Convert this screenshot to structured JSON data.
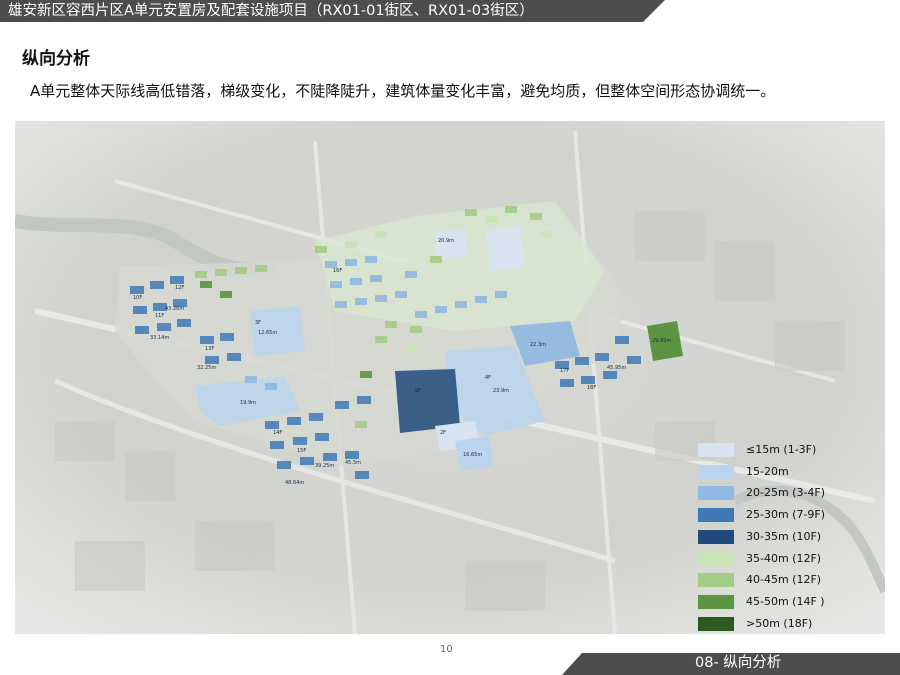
{
  "header": {
    "title": "雄安新区容西片区A单元安置房及配套设施项目（RX01-01街区、RX01-03街区）",
    "banner_color": "#4d4d4d"
  },
  "section": {
    "title": "纵向分析",
    "description": "A单元整体天际线高低错落，梯级变化，不陡降陡升，建筑体量变化丰富，避免均质，但整体空间形态协调统一。"
  },
  "map": {
    "building_labels": [
      "10F",
      "11F",
      "12F",
      "13F",
      "14F",
      "15F",
      "16F",
      "17F",
      "18F",
      "3F",
      "4F",
      "2F",
      "9F",
      "12.65m",
      "16.65m",
      "19.9m",
      "20.9m",
      "22.3m",
      "23.9m",
      "29.45m",
      "32.25m",
      "33.14m",
      "39.25m",
      "43.26m",
      "45.5m",
      "45.95m",
      "48.64m"
    ]
  },
  "legend": {
    "items": [
      {
        "label": "≤15m (1-3F)",
        "color": "#d7e3ef"
      },
      {
        "label": "15-20m",
        "color": "#bcd5ec"
      },
      {
        "label": "20-25m (3-4F)",
        "color": "#8fb8e2"
      },
      {
        "label": "25-30m (7-9F)",
        "color": "#3f79b6"
      },
      {
        "label": "30-35m (10F)",
        "color": "#1f4a7a"
      },
      {
        "label": "35-40m (12F)",
        "color": "#c9e4b7"
      },
      {
        "label": "40-45m (12F)",
        "color": "#a3cd85"
      },
      {
        "label": "45-50m (14F )",
        "color": "#5c9443"
      },
      {
        "label": ">50m (18F)",
        "color": "#2e5a22"
      }
    ]
  },
  "footer": {
    "page_number": "10",
    "section_label": "08- 纵向分析",
    "banner_color": "#4d4d4d"
  }
}
